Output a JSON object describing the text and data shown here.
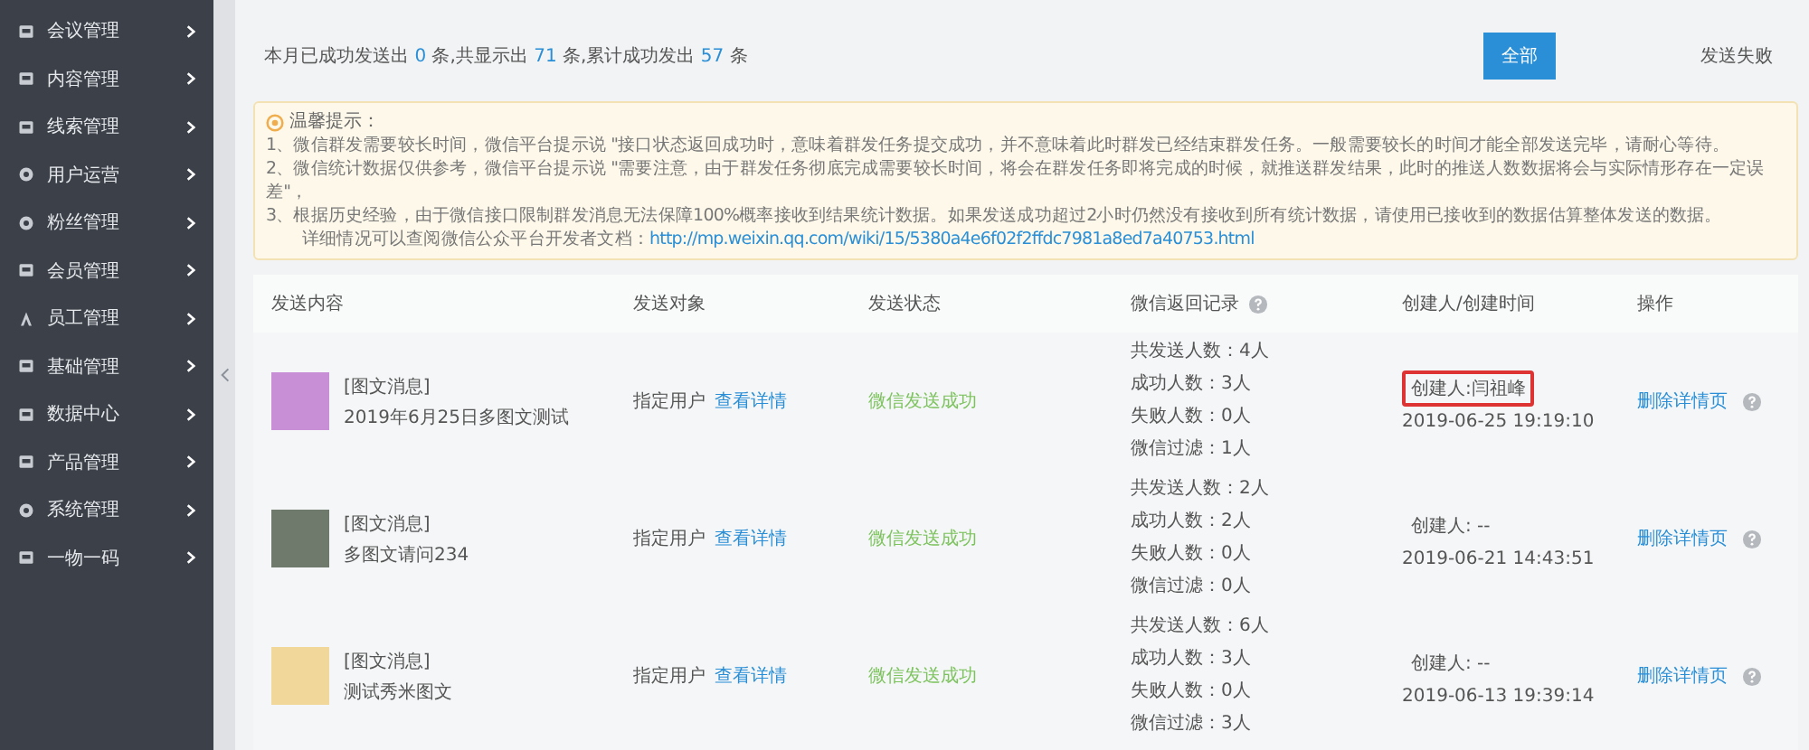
{
  "sidebar": {
    "items": [
      {
        "label": "会议管理"
      },
      {
        "label": "内容管理"
      },
      {
        "label": "线索管理"
      },
      {
        "label": "用户运营"
      },
      {
        "label": "粉丝管理"
      },
      {
        "label": "会员管理"
      },
      {
        "label": "员工管理"
      },
      {
        "label": "基础管理"
      },
      {
        "label": "数据中心"
      },
      {
        "label": "产品管理"
      },
      {
        "label": "系统管理"
      },
      {
        "label": "一物一码"
      }
    ]
  },
  "summary": {
    "prefix": "本月已成功发送出",
    "sent": "0",
    "mid1": "条,共显示出",
    "shown": "71",
    "mid2": "条,累计成功发出",
    "total": "57",
    "suffix": "条"
  },
  "filters": [
    {
      "label": "全部",
      "selected": true
    },
    {
      "label": "发送失败",
      "selected": false
    }
  ],
  "notice": {
    "title": "温馨提示：",
    "lines": [
      "1、微信群发需要较长时间，微信平台提示说 \"接口状态返回成功时，意味着群发任务提交成功，并不意味着此时群发已经结束群发任务。一般需要较长的时间才能全部发送完毕，请耐心等待。",
      "2、微信统计数据仅供参考，微信平台提示说 \"需要注意，由于群发任务彻底完成需要较长时间，将会在群发任务即将完成的时候，就推送群发结果，此时的推送人数数据将会与实际情形存在一定误差\"，",
      "3、根据历史经验，由于微信接口限制群发消息无法保障100%概率接收到结果统计数据。如果发送成功超过2小时仍然没有接收到所有统计数据，请使用已接收到的数据估算整体发送的数据。"
    ],
    "doc_label": "详细情况可以查阅微信公众平台开发者文档：",
    "doc_link": "http://mp.weixin.qq.com/wiki/15/5380a4e6f02f2ffdc7981a8ed7a40753.html"
  },
  "table": {
    "columns": [
      "发送内容",
      "发送对象",
      "发送状态",
      "微信返回记录",
      "创建人/创建时间",
      "操作"
    ],
    "rows": [
      {
        "type": "[图文消息]",
        "title": "2019年6月25日多图文测试",
        "target": "指定用户",
        "detail_link": "查看详情",
        "status": "微信发送成功",
        "stats": [
          "共发送人数：4人",
          "成功人数：3人",
          "失败人数：0人",
          "微信过滤：1人"
        ],
        "creator": "创建人:闫祖峰",
        "created": "2019-06-25 19:19:10",
        "highlighted": true,
        "action": "删除详情页"
      },
      {
        "type": "[图文消息]",
        "title": "多图文请问234",
        "target": "指定用户",
        "detail_link": "查看详情",
        "status": "微信发送成功",
        "stats": [
          "共发送人数：2人",
          "成功人数：2人",
          "失败人数：0人",
          "微信过滤：0人"
        ],
        "creator": "创建人: --",
        "created": "2019-06-21 14:43:51",
        "highlighted": false,
        "action": "删除详情页"
      },
      {
        "type": "[图文消息]",
        "title": "测试秀米图文",
        "target": "指定用户",
        "detail_link": "查看详情",
        "status": "微信发送成功",
        "stats": [
          "共发送人数：6人",
          "成功人数：3人",
          "失败人数：0人",
          "微信过滤：3人"
        ],
        "creator": "创建人: --",
        "created": "2019-06-13 19:39:14",
        "highlighted": false,
        "action": "删除详情页"
      }
    ]
  }
}
